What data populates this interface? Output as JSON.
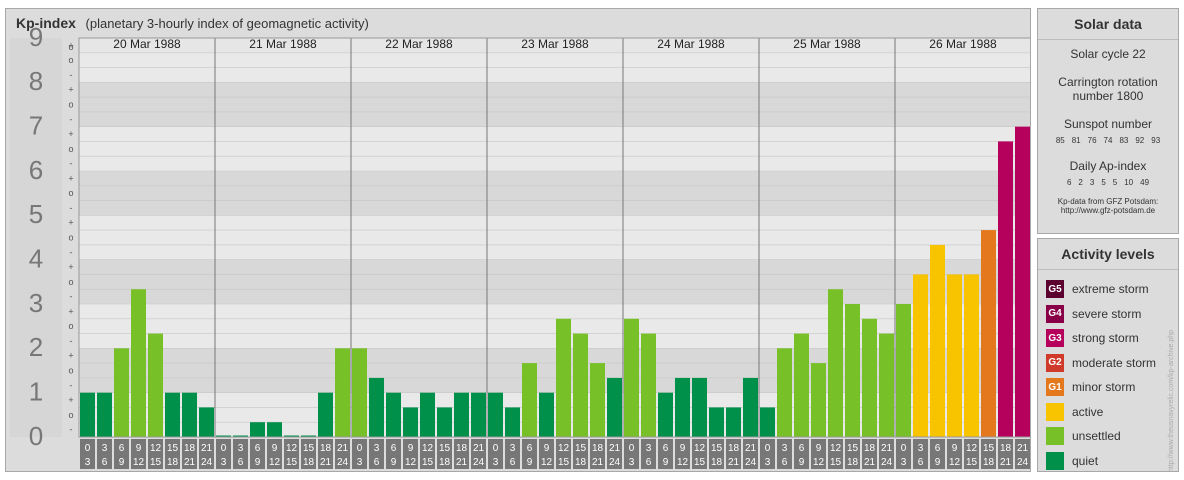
{
  "title": "Kp-index",
  "subtitle": "(planetary 3-hourly index of geomagnetic activity)",
  "chart_data": {
    "type": "bar",
    "title": "Kp-index",
    "subtitle": "(planetary 3-hourly index of geomagnetic activity)",
    "ylim": [
      0,
      9
    ],
    "y_ticks": [
      "0",
      "1",
      "2",
      "3",
      "4",
      "5",
      "6",
      "7",
      "8",
      "9"
    ],
    "thirds_labels": [
      "-",
      "o",
      "+"
    ],
    "interval_top": [
      "0",
      "3",
      "6",
      "9",
      "12",
      "15",
      "18",
      "21"
    ],
    "interval_bottom": [
      "3",
      "6",
      "9",
      "12",
      "15",
      "18",
      "21",
      "24"
    ],
    "days": [
      {
        "date": "20 Mar 1988",
        "values": [
          1,
          1,
          2,
          3.333,
          2.333,
          1,
          1,
          0.667
        ]
      },
      {
        "date": "21 Mar 1988",
        "values": [
          0,
          0,
          0.333,
          0.333,
          0,
          0,
          1,
          2
        ]
      },
      {
        "date": "22 Mar 1988",
        "values": [
          2,
          1.333,
          1,
          0.667,
          1,
          0.667,
          1,
          1
        ]
      },
      {
        "date": "23 Mar 1988",
        "values": [
          1,
          0.667,
          1.667,
          1,
          2.667,
          2.333,
          1.667,
          1.333
        ]
      },
      {
        "date": "24 Mar 1988",
        "values": [
          2.667,
          2.333,
          1,
          1.333,
          1.333,
          0.667,
          0.667,
          1.333
        ]
      },
      {
        "date": "25 Mar 1988",
        "values": [
          0.667,
          2,
          2.333,
          1.667,
          3.333,
          3,
          2.667,
          2.333
        ]
      },
      {
        "date": "26 Mar 1988",
        "values": [
          3,
          3.667,
          4.333,
          3.667,
          3.667,
          4.667,
          6.667,
          7
        ]
      }
    ],
    "colors": {
      "quiet": "#00904a",
      "unsettled": "#77c028",
      "active": "#f8c400",
      "minor": "#e4781c",
      "moderate": "#cf3a2a",
      "strong": "#b5005c",
      "severe": "#8a0048",
      "extreme": "#5c0030"
    }
  },
  "solar": {
    "heading": "Solar data",
    "cycle": "Solar cycle 22",
    "carrington_1": "Carrington rotation",
    "carrington_2": "number 1800",
    "sunspot_label": "Sunspot number",
    "sunspot_values": [
      "85",
      "81",
      "76",
      "74",
      "83",
      "92",
      "93"
    ],
    "ap_label": "Daily Ap-index",
    "ap_values": [
      "6",
      "2",
      "3",
      "5",
      "5",
      "10",
      "49"
    ],
    "source_1": "Kp-data from GFZ Potsdam:",
    "source_2": "http://www.gfz-potsdam.de"
  },
  "levels": {
    "heading": "Activity levels",
    "items": [
      {
        "badge": "G5",
        "label": "extreme storm",
        "color": "#5c0030"
      },
      {
        "badge": "G4",
        "label": "severe storm",
        "color": "#8a0048"
      },
      {
        "badge": "G3",
        "label": "strong storm",
        "color": "#b5005c"
      },
      {
        "badge": "G2",
        "label": "moderate storm",
        "color": "#cf3a2a"
      },
      {
        "badge": "G1",
        "label": "minor storm",
        "color": "#e4781c"
      },
      {
        "badge": "",
        "label": "active",
        "color": "#f8c400"
      },
      {
        "badge": "",
        "label": "unsettled",
        "color": "#77c028"
      },
      {
        "badge": "",
        "label": "quiet",
        "color": "#00904a"
      }
    ]
  },
  "credit": "http://www.theusnavyrelic.com/kp-archive.php"
}
